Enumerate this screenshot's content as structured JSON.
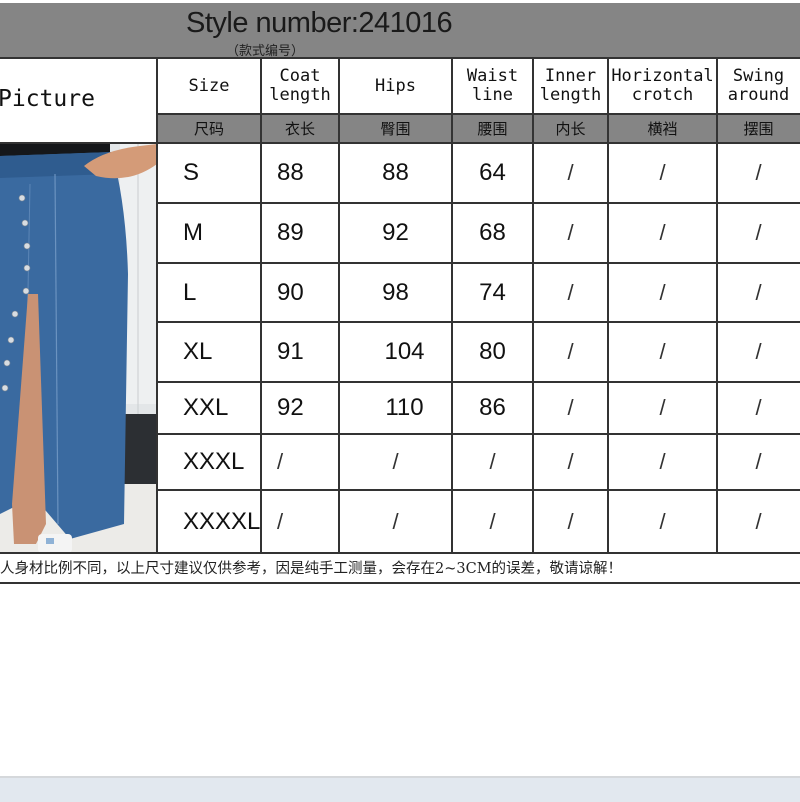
{
  "header": {
    "title": "Style number:241016",
    "subtitle": "（款式编号）"
  },
  "table": {
    "picture_label": "Picture",
    "columns": [
      {
        "en": "Size",
        "cn": "尺码"
      },
      {
        "en": "Coat\nlength",
        "cn": "衣长"
      },
      {
        "en": "Hips",
        "cn": "臀围"
      },
      {
        "en": "Waist\nline",
        "cn": "腰围"
      },
      {
        "en": "Inner\nlength",
        "cn": "内长"
      },
      {
        "en": "Horizontal\ncrotch",
        "cn": "横裆"
      },
      {
        "en": "Swing\naround",
        "cn": "摆围"
      }
    ],
    "rows": [
      {
        "size": "S",
        "coat_length": "88",
        "hips": "88",
        "waistline": "64",
        "inner_length": "/",
        "horizontal_crotch": "/",
        "swing_around": "/"
      },
      {
        "size": "M",
        "coat_length": "89",
        "hips": "92",
        "waistline": "68",
        "inner_length": "/",
        "horizontal_crotch": "/",
        "swing_around": "/"
      },
      {
        "size": "L",
        "coat_length": "90",
        "hips": "98",
        "waistline": "74",
        "inner_length": "/",
        "horizontal_crotch": "/",
        "swing_around": "/"
      },
      {
        "size": "XL",
        "coat_length": "91",
        "hips": "104",
        "waistline": "80",
        "inner_length": "/",
        "horizontal_crotch": "/",
        "swing_around": "/"
      },
      {
        "size": "XXL",
        "coat_length": "92",
        "hips": "110",
        "waistline": "86",
        "inner_length": "/",
        "horizontal_crotch": "/",
        "swing_around": "/"
      },
      {
        "size": "XXXL",
        "coat_length": "/",
        "hips": "/",
        "waistline": "/",
        "inner_length": "/",
        "horizontal_crotch": "/",
        "swing_around": "/"
      },
      {
        "size": "XXXXL",
        "coat_length": "/",
        "hips": "/",
        "waistline": "/",
        "inner_length": "/",
        "horizontal_crotch": "/",
        "swing_around": "/"
      }
    ]
  },
  "footnote": "人身材比例不同，以上尺寸建议仅供参考，因是纯手工测量，会存在2~3CM的误差，敬请谅解！",
  "photo": {
    "subject": "denim-midi-skirt-front-buttons-slit",
    "accent": "#3a6aa0"
  }
}
